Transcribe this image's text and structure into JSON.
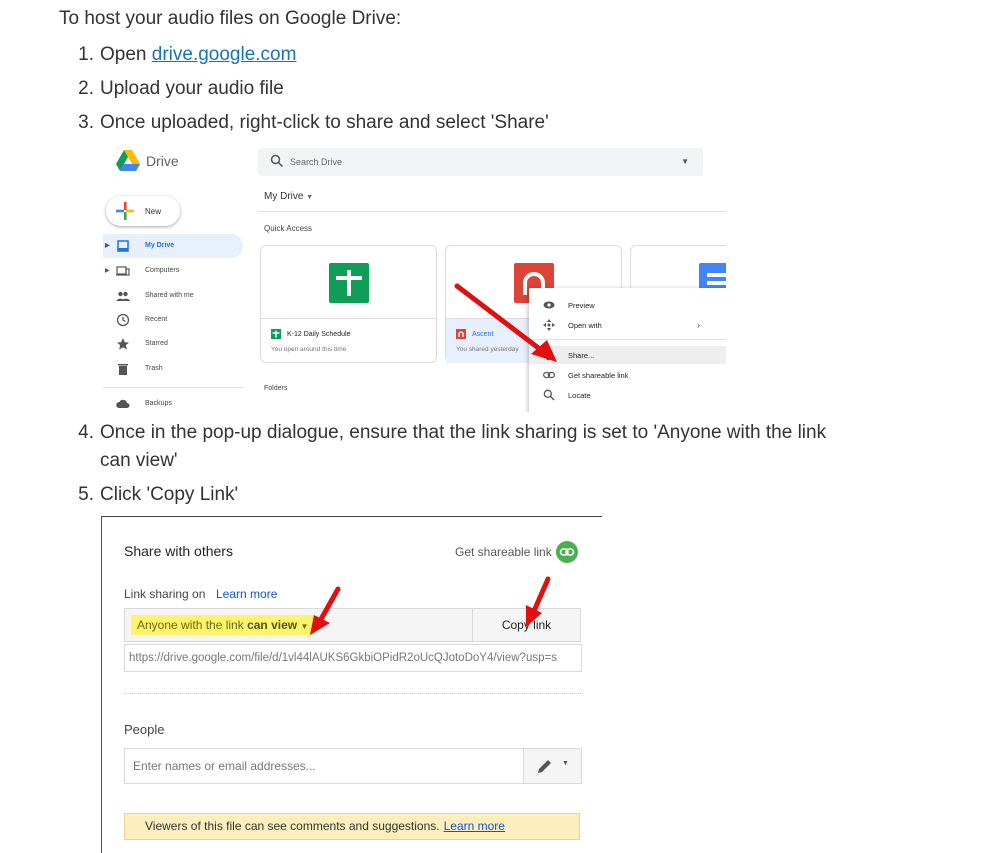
{
  "intro": "To host your audio files on Google Drive:",
  "steps": [
    {
      "num": "1.",
      "text": "Open ",
      "link": "drive.google.com"
    },
    {
      "num": "2.",
      "text": "Upload your audio file"
    },
    {
      "num": "3.",
      "text": "Once uploaded, right-click to share and select 'Share'"
    },
    {
      "num": "4.",
      "text": "Once in the pop-up dialogue, ensure that the link sharing is set to 'Anyone with the link",
      "text2": "can view'"
    },
    {
      "num": "5.",
      "text": "Click 'Copy Link'"
    }
  ],
  "drive": {
    "app_name": "Drive",
    "search_placeholder": "Search Drive",
    "new_label": "New",
    "nav": [
      "My Drive",
      "Computers",
      "Shared with me",
      "Recent",
      "Starred",
      "Trash",
      "Backups"
    ],
    "breadcrumb": "My Drive",
    "quick_access": "Quick Access",
    "cards": [
      {
        "name": "K-12 Daily Schedule",
        "sub": "You open around this time"
      },
      {
        "name": "Ascent",
        "sub": "You shared yesterday"
      }
    ],
    "folders": "Folders",
    "context_menu": [
      "Preview",
      "Open with",
      "Share...",
      "Get shareable link",
      "Locate"
    ],
    "colors": {
      "sheets_green": "#0f9d58",
      "red_app": "#db4437",
      "docs_blue": "#4285f4"
    }
  },
  "share_dialog": {
    "title": "Share with others",
    "get_link": "Get shareable link",
    "link_sharing": "Link sharing on",
    "learn_more": "Learn more",
    "permission_pre": "Anyone with the link ",
    "permission_bold": "can view",
    "copy_link": "Copy link",
    "url": "https://drive.google.com/file/d/1vl44lAUKS6GkbiOPidR2oUcQJotoDoY4/view?usp=s",
    "people_label": "People",
    "names_placeholder": "Enter names or email addresses...",
    "notice": "Viewers of this file can see comments and suggestions.",
    "notice_link": "Learn more"
  }
}
